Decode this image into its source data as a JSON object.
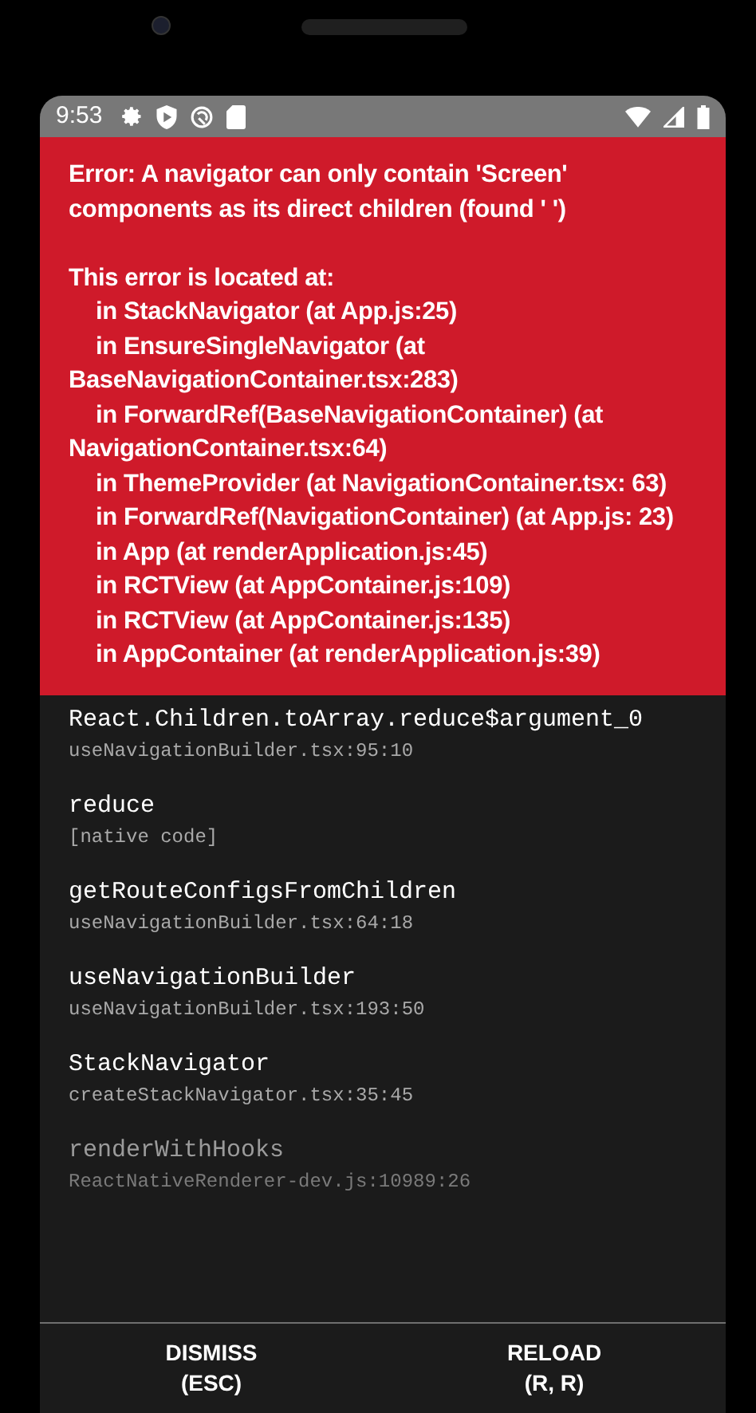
{
  "status_bar": {
    "time": "9:53"
  },
  "error": {
    "message": "Error: A navigator can only contain 'Screen' components as its direct children (found ' ')",
    "located_heading": "This error is located at:",
    "stack": [
      "in StackNavigator (at App.js:25)",
      "in EnsureSingleNavigator (at BaseNavigationContainer.tsx:283)",
      "in ForwardRef(BaseNavigationContainer) (at NavigationContainer.tsx:64)",
      "in ThemeProvider (at NavigationContainer.tsx: 63)",
      "in ForwardRef(NavigationContainer) (at App.js: 23)",
      "in App (at renderApplication.js:45)",
      "in RCTView (at AppContainer.js:109)",
      "in RCTView (at AppContainer.js:135)",
      "in AppContainer (at renderApplication.js:39)"
    ]
  },
  "frames": [
    {
      "method": "React.Children.toArray.reduce$argument_0",
      "location": "useNavigationBuilder.tsx:95:10",
      "dimmed": false
    },
    {
      "method": "reduce",
      "location": "[native code]",
      "dimmed": false
    },
    {
      "method": "getRouteConfigsFromChildren",
      "location": "useNavigationBuilder.tsx:64:18",
      "dimmed": false
    },
    {
      "method": "useNavigationBuilder",
      "location": "useNavigationBuilder.tsx:193:50",
      "dimmed": false
    },
    {
      "method": "StackNavigator",
      "location": "createStackNavigator.tsx:35:45",
      "dimmed": false
    },
    {
      "method": "renderWithHooks",
      "location": "ReactNativeRenderer-dev.js:10989:26",
      "dimmed": true
    }
  ],
  "buttons": [
    {
      "label": "DISMISS",
      "shortcut": "(ESC)"
    },
    {
      "label": "RELOAD",
      "shortcut": "(R, R)"
    }
  ]
}
